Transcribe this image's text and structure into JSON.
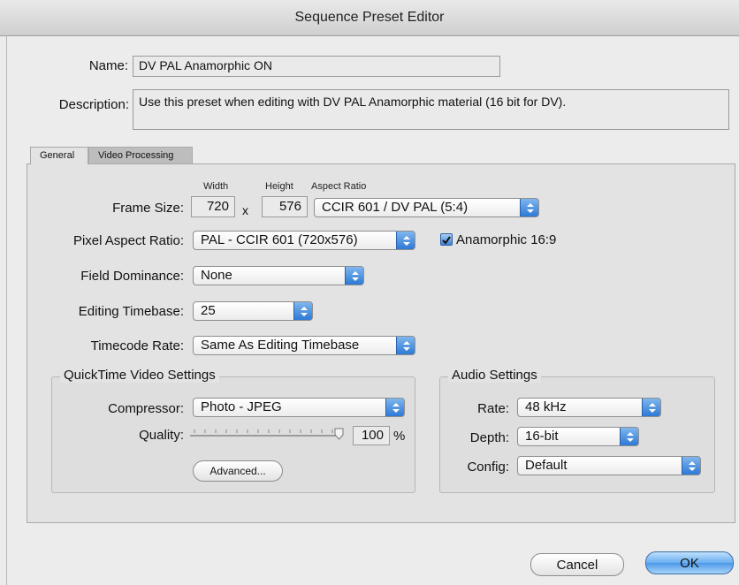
{
  "window": {
    "title": "Sequence Preset Editor"
  },
  "preset": {
    "name_label": "Name:",
    "name_value": "DV PAL Anamorphic ON",
    "description_label": "Description:",
    "description_value": "Use this preset when editing with DV PAL Anamorphic material (16 bit for DV)."
  },
  "tabs": [
    {
      "label": "General",
      "active": true
    },
    {
      "label": "Video Processing",
      "active": false
    }
  ],
  "general": {
    "frame_size_label": "Frame Size:",
    "width_header": "Width",
    "height_header": "Height",
    "aspect_header": "Aspect Ratio",
    "width_value": "720",
    "times": "x",
    "height_value": "576",
    "aspect_ratio_value": "CCIR 601 / DV PAL (5:4)",
    "pixel_aspect_label": "Pixel Aspect Ratio:",
    "pixel_aspect_value": "PAL - CCIR 601 (720x576)",
    "anamorphic_label": "Anamorphic 16:9",
    "anamorphic_checked": true,
    "field_dominance_label": "Field Dominance:",
    "field_dominance_value": "None",
    "editing_timebase_label": "Editing Timebase:",
    "editing_timebase_value": "25",
    "timecode_rate_label": "Timecode Rate:",
    "timecode_rate_value": "Same As Editing Timebase"
  },
  "quicktime": {
    "group_title": "QuickTime Video Settings",
    "compressor_label": "Compressor:",
    "compressor_value": "Photo - JPEG",
    "quality_label": "Quality:",
    "quality_value": "100",
    "quality_unit": "%",
    "quality_fraction": 1.0,
    "advanced_label": "Advanced..."
  },
  "audio": {
    "group_title": "Audio Settings",
    "rate_label": "Rate:",
    "rate_value": "48 kHz",
    "depth_label": "Depth:",
    "depth_value": "16-bit",
    "config_label": "Config:",
    "config_value": "Default"
  },
  "buttons": {
    "cancel": "Cancel",
    "ok": "OK"
  },
  "colors": {
    "accent": "#3d84d8",
    "default_button": "#68aef0"
  }
}
